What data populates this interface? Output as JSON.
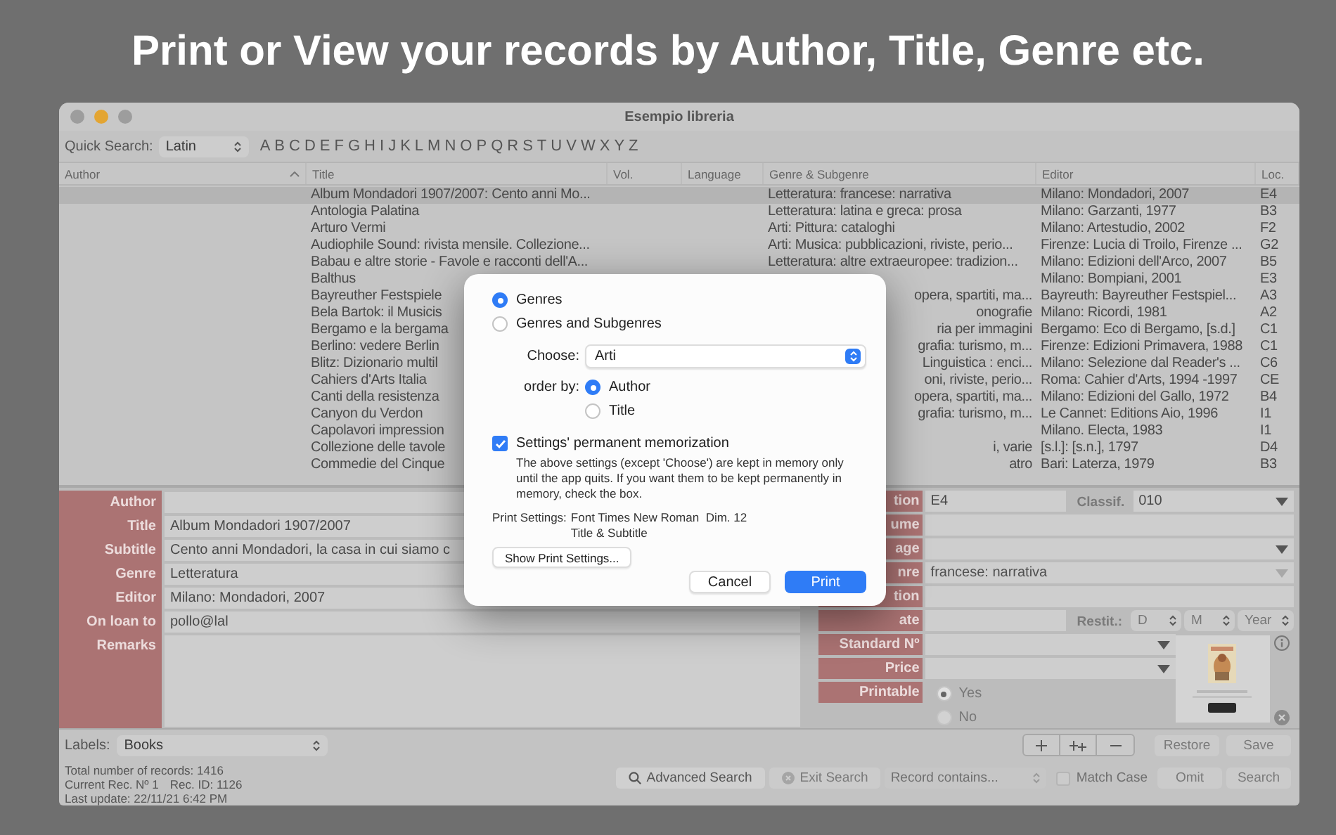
{
  "headline": "Print or View your records by Author, Title, Genre etc.",
  "window": {
    "title": "Esempio libreria"
  },
  "quick_search": {
    "label": "Quick Search:",
    "value": "Latin",
    "letters": [
      "A",
      "B",
      "C",
      "D",
      "E",
      "F",
      "G",
      "H",
      "I",
      "J",
      "K",
      "L",
      "M",
      "N",
      "O",
      "P",
      "Q",
      "R",
      "S",
      "T",
      "U",
      "V",
      "W",
      "X",
      "Y",
      "Z"
    ]
  },
  "table": {
    "columns": [
      {
        "label": "Author",
        "sorted": true
      },
      {
        "label": "Title",
        "sorted": false
      },
      {
        "label": "Vol.",
        "sorted": false
      },
      {
        "label": "Language",
        "sorted": false
      },
      {
        "label": "Genre & Subgenre",
        "sorted": false
      },
      {
        "label": "Editor",
        "sorted": false
      },
      {
        "label": "Loc.",
        "sorted": false
      }
    ],
    "rows": [
      {
        "title": "Album Mondadori 1907/2007: Cento anni Mo...",
        "genre": "Letteratura: francese: narrativa",
        "editor": "Milano: Mondadori, 2007",
        "loc": "E4",
        "selected": true
      },
      {
        "title": "Antologia Palatina",
        "genre": "Letteratura: latina e greca: prosa",
        "editor": "Milano: Garzanti, 1977",
        "loc": "B3",
        "selected": false
      },
      {
        "title": "Arturo Vermi",
        "genre": "Arti: Pittura: cataloghi",
        "editor": "Milano: Artestudio, 2002",
        "loc": "F2",
        "selected": false
      },
      {
        "title": "Audiophile Sound: rivista mensile. Collezione...",
        "genre": "Arti: Musica: pubblicazioni, riviste, perio...",
        "editor": "Firenze: Lucia di Troilo, Firenze ...",
        "loc": "G2",
        "selected": false
      },
      {
        "title": "Babau e altre storie - Favole e racconti dell'A...",
        "genre": "Letteratura: altre extraeuropee: tradizion...",
        "editor": "Milano: Edizioni dell'Arco, 2007",
        "loc": "B5",
        "selected": false
      },
      {
        "title": "Balthus",
        "editor": "Milano: Bompiani, 2001",
        "loc": "E3",
        "selected": false
      },
      {
        "title": "Bayreuther Festspiele",
        "genre_end": "opera, spartiti, ma...",
        "editor": "Bayreuth: Bayreuther Festspiel...",
        "loc": "A3",
        "selected": false
      },
      {
        "title": "Bela Bartok: il Musicis",
        "genre_end": "onografie",
        "editor": "Milano: Ricordi, 1981",
        "loc": "A2",
        "selected": false
      },
      {
        "title": "Bergamo e la bergama",
        "genre_end": "ria per immagini",
        "editor": "Bergamo: Eco di Bergamo, [s.d.]",
        "loc": "C1",
        "selected": false
      },
      {
        "title": "Berlino: vedere Berlin",
        "genre_end": "grafia: turismo, m...",
        "editor": "Firenze: Edizioni Primavera, 1988",
        "loc": "C1",
        "selected": false
      },
      {
        "title": "Blitz: Dizionario multil",
        "genre_end": "Linguistica : enci...",
        "editor": "Milano: Selezione dal Reader's ...",
        "loc": "C6",
        "selected": false
      },
      {
        "title": "Cahiers d'Arts Italia",
        "genre_end": "oni, riviste, perio...",
        "editor": "Roma: Cahier d'Arts, 1994 -1997",
        "loc": "CE",
        "selected": false
      },
      {
        "title": "Canti della resistenza",
        "genre_end": "opera, spartiti, ma...",
        "editor": "Milano: Edizioni del Gallo, 1972",
        "loc": "B4",
        "selected": false
      },
      {
        "title": "Canyon du Verdon",
        "genre_end": "grafia: turismo, m...",
        "editor": "Le Cannet: Editions Aio, 1996",
        "loc": "I1",
        "selected": false
      },
      {
        "title": "Capolavori impression",
        "editor": "Milano. Electa, 1983",
        "loc": "I1",
        "selected": false
      },
      {
        "title": "Collezione delle tavole",
        "genre_end": "i, varie",
        "editor": "[s.l.]: [s.n.], 1797",
        "loc": "D4",
        "selected": false
      },
      {
        "title": "Commedie del Cinque",
        "genre_end": "atro",
        "editor": "Bari: Laterza, 1979",
        "loc": "B3",
        "selected": false
      }
    ]
  },
  "form_left": [
    {
      "label": "Author",
      "kind": "line"
    },
    {
      "label": "Title",
      "kind": "line",
      "value": "Album Mondadori 1907/2007"
    },
    {
      "label": "Subtitle",
      "kind": "line",
      "value": "Cento anni Mondadori, la casa in cui siamo c"
    },
    {
      "label": "Genre",
      "kind": "line",
      "value": "Letteratura"
    },
    {
      "label": "Editor",
      "kind": "line",
      "value": "Milano: Mondadori, 2007"
    },
    {
      "label": "On loan to",
      "kind": "line",
      "value": "pollo@lal"
    },
    {
      "label": "Remarks",
      "kind": "area"
    }
  ],
  "form_right": {
    "rows": [
      {
        "kind": "location",
        "label": "tion",
        "value": "E4",
        "extra_label": "Classif.",
        "extra_value": "010",
        "disabled": false
      },
      {
        "kind": "text",
        "label": "ume",
        "disabled": false
      },
      {
        "kind": "menu",
        "label": "age",
        "disabled": false
      },
      {
        "kind": "menu",
        "label": "nre",
        "value": "francese: narrativa",
        "disabled": true
      },
      {
        "kind": "text",
        "label": "tion",
        "disabled": false
      },
      {
        "kind": "date",
        "label": "ate",
        "extra_label": "Restit.:",
        "steppers": [
          "D",
          "M",
          "Year"
        ],
        "disabled": false
      }
    ],
    "lower_rows": [
      {
        "label": "Standard Nº"
      },
      {
        "label": "Price"
      }
    ],
    "printable": {
      "label": "Printable",
      "options": [
        {
          "label": "Yes",
          "selected": true
        },
        {
          "label": "No",
          "selected": false
        }
      ]
    }
  },
  "labels_bar": {
    "label": "Labels:",
    "value": "Books",
    "buttons": [
      {
        "label": "Restore",
        "disabled": true
      },
      {
        "label": "Save",
        "disabled": true
      }
    ]
  },
  "stats": {
    "total": "Total number of records: 1416",
    "current": "Current Rec. Nº 1",
    "rec_id": "Rec. ID: 1126",
    "last_update": "Last update: 22/11/21  6:42 PM"
  },
  "search_bar": {
    "advanced": {
      "label": "Advanced Search",
      "disabled": false
    },
    "exit": {
      "label": "Exit Search",
      "disabled": true
    },
    "record_contains": {
      "placeholder": "Record contains..."
    },
    "match_case": {
      "label": "Match Case",
      "checked": false
    },
    "buttons": [
      {
        "label": "Omit",
        "disabled": true
      },
      {
        "label": "Search",
        "disabled": true
      }
    ]
  },
  "dialog": {
    "group_options": [
      {
        "label": "Genres",
        "selected": true
      },
      {
        "label": "Genres and Subgenres",
        "selected": false
      }
    ],
    "choose": {
      "label": "Choose:",
      "value": "Arti"
    },
    "order_by": {
      "label": "order by:",
      "options": [
        {
          "label": "Author",
          "selected": true
        },
        {
          "label": "Title",
          "selected": false
        }
      ]
    },
    "memorize": {
      "label": "Settings' permanent memorization",
      "checked": true,
      "note": "The above settings (except 'Choose') are kept in memory only until the app quits. If you want them to be kept permanently in memory, check the box."
    },
    "print_settings": {
      "label": "Print Settings:",
      "lines": [
        "Font Times New Roman  Dim. 12",
        "Title & Subtitle"
      ]
    },
    "show_button": "Show Print Settings...",
    "buttons": [
      {
        "label": "Cancel",
        "kind": "secondary"
      },
      {
        "label": "Print",
        "kind": "primary"
      }
    ]
  }
}
